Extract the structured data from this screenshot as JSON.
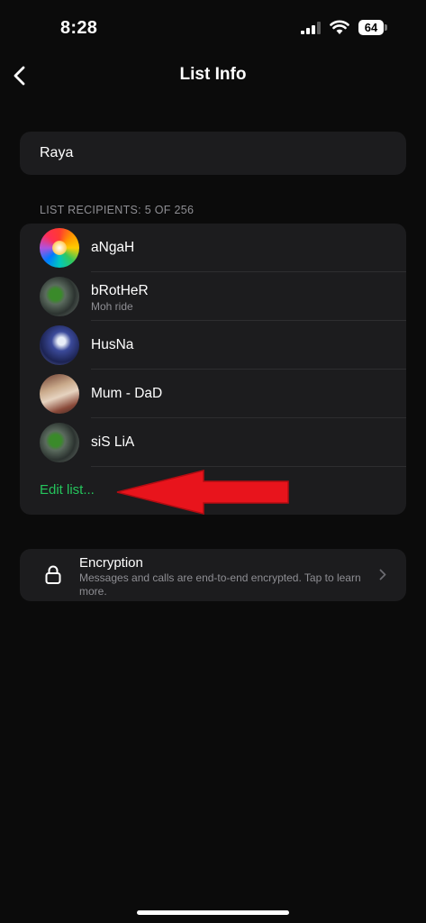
{
  "status_bar": {
    "time": "8:28",
    "battery": "64",
    "icons": [
      "signal-icon",
      "wifi-icon",
      "battery-icon"
    ]
  },
  "nav": {
    "title": "List Info",
    "back_icon": "chevron-left-icon"
  },
  "list_name": "Raya",
  "recipients": {
    "header": "LIST RECIPIENTS: 5 OF 256",
    "items": [
      {
        "name": "aNgaH",
        "subtitle": ""
      },
      {
        "name": "bRotHeR",
        "subtitle": "Moh ride"
      },
      {
        "name": "HusNa",
        "subtitle": ""
      },
      {
        "name": "Mum - DaD",
        "subtitle": ""
      },
      {
        "name": "siS LiA",
        "subtitle": ""
      }
    ],
    "edit_label": "Edit list..."
  },
  "encryption": {
    "title": "Encryption",
    "description": "Messages and calls are end-to-end encrypted. Tap to learn more.",
    "icon": "lock-icon"
  },
  "colors": {
    "background": "#0b0b0b",
    "card": "#1c1c1e",
    "accent_green": "#25c45c",
    "secondary_text": "#8e8e93",
    "annotation_arrow": "#e8141c"
  }
}
